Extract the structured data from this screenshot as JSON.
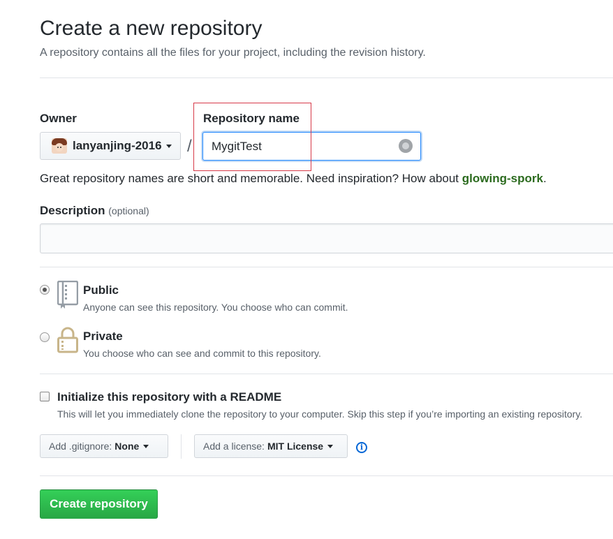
{
  "header": {
    "title": "Create a new repository",
    "subtitle": "A repository contains all the files for your project, including the revision history."
  },
  "owner": {
    "label": "Owner",
    "name": "lanyanjing-2016"
  },
  "repo": {
    "label": "Repository name",
    "slash": "/",
    "value": "MygitTest"
  },
  "hint": {
    "text": "Great repository names are short and memorable. Need inspiration? How about ",
    "suggestion": "glowing-spork",
    "end": "."
  },
  "description": {
    "label": "Description",
    "optional": "(optional)",
    "value": ""
  },
  "visibility": {
    "public": {
      "title": "Public",
      "desc": "Anyone can see this repository. You choose who can commit.",
      "selected": true
    },
    "private": {
      "title": "Private",
      "desc": "You choose who can see and commit to this repository.",
      "selected": false
    }
  },
  "readme": {
    "title": "Initialize this repository with a README",
    "desc": "This will let you immediately clone the repository to your computer. Skip this step if you’re importing an existing repository.",
    "checked": false
  },
  "gitignore": {
    "label": "Add .gitignore:",
    "value": "None"
  },
  "license": {
    "label": "Add a license:",
    "value": "MIT License"
  },
  "create_button": "Create repository",
  "colors": {
    "primary_green": "#28a745",
    "focus_blue": "#2188ff",
    "highlight_red": "#d73a49",
    "suggestion_green": "#2c6b1f"
  }
}
